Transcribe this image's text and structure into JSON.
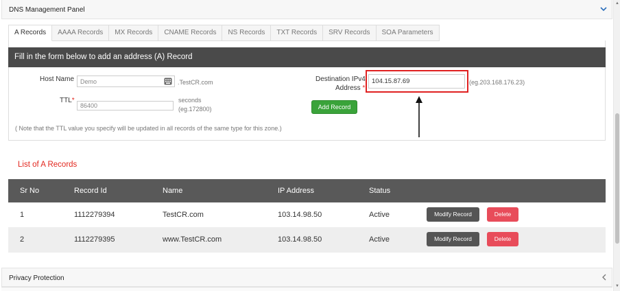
{
  "panel": {
    "title": "DNS Management Panel"
  },
  "tabs": [
    {
      "label": "A Records",
      "active": true
    },
    {
      "label": "AAAA Records",
      "active": false
    },
    {
      "label": "MX Records",
      "active": false
    },
    {
      "label": "CNAME Records",
      "active": false
    },
    {
      "label": "NS Records",
      "active": false
    },
    {
      "label": "TXT Records",
      "active": false
    },
    {
      "label": "SRV Records",
      "active": false
    },
    {
      "label": "SOA Parameters",
      "active": false
    }
  ],
  "form": {
    "heading": "Fill in the form below to add an address (A) Record",
    "host_label": "Host Name",
    "host_value": "Demo",
    "host_suffix": ".TestCR.com",
    "ttl_label": "TTL",
    "required_mark": "*",
    "ttl_value": "86400",
    "ttl_unit": "seconds",
    "ttl_hint": "(eg.172800)",
    "dest_label_line1": "Destination IPv4",
    "dest_label_line2": "Address",
    "dest_value": "104.15.87.69",
    "dest_hint": "(eg.203.168.176.23)",
    "add_button": "Add Record",
    "note": "( Note that the TTL value you specify will be updated in all records of the same type for this zone.)"
  },
  "list": {
    "title": "List of A Records",
    "columns": [
      "Sr No",
      "Record Id",
      "Name",
      "IP Address",
      "Status"
    ],
    "rows": [
      {
        "sr": "1",
        "record_id": "1112279394",
        "name": "TestCR.com",
        "ip": "103.14.98.50",
        "status": "Active"
      },
      {
        "sr": "2",
        "record_id": "1112279395",
        "name": "www.TestCR.com",
        "ip": "103.14.98.50",
        "status": "Active"
      }
    ],
    "modify_label": "Modify Record",
    "delete_label": "Delete"
  },
  "privacy": {
    "title": "Privacy Protection"
  },
  "colors": {
    "header_dark": "#4a4a4a",
    "table_head": "#595959",
    "accent_red": "#e2261d",
    "add_green": "#3aa33a",
    "delete_red": "#e84c5a"
  },
  "icons": [
    "chevron-down-icon",
    "keyboard-icon",
    "arrow-up-icon",
    "chevron-left-icon"
  ]
}
